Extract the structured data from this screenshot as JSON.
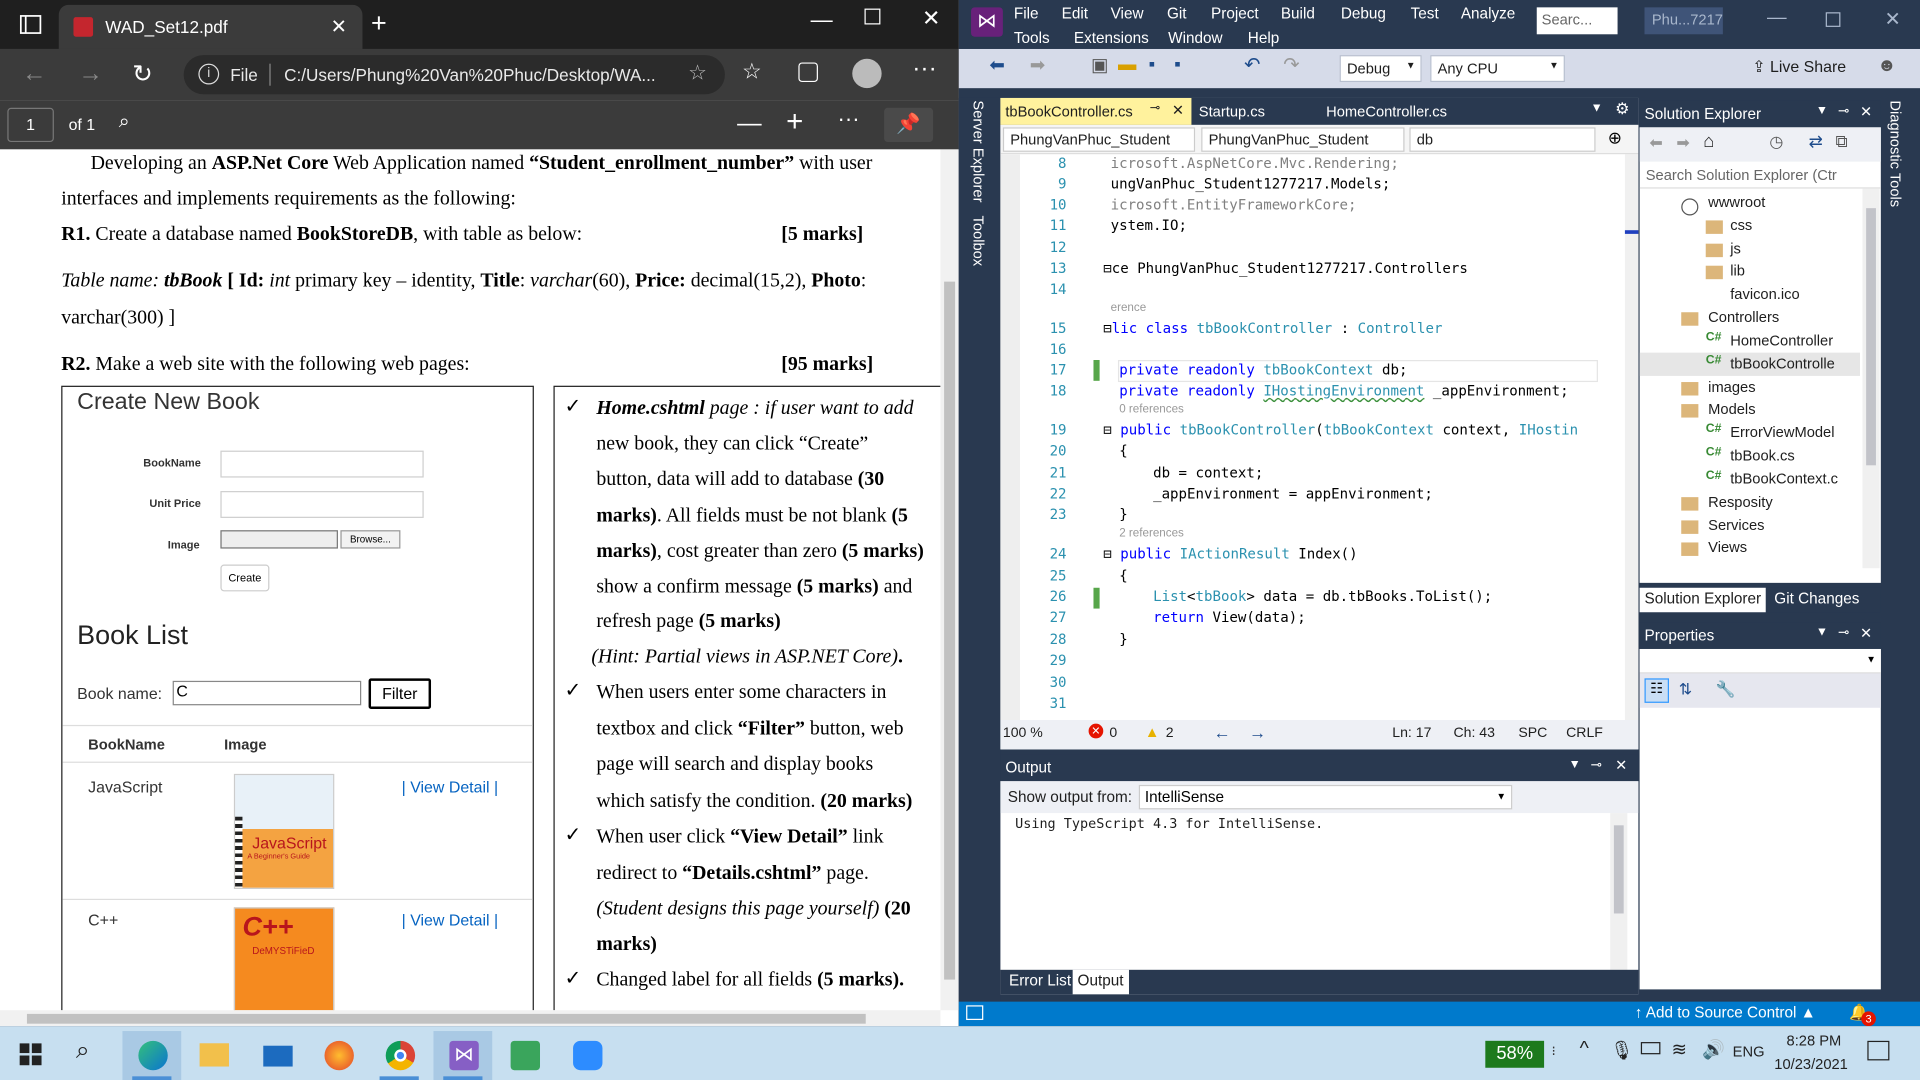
{
  "colors": {
    "edge_dark": "#1f1f1f",
    "edge_mid": "#3b3b3b",
    "vs_dark": "#293950",
    "vs_blue": "#007acc",
    "vs_active_tab": "#fff29d",
    "link_blue": "#0563c1"
  },
  "edge": {
    "tab_title": "WAD_Set12.pdf",
    "url_scheme": "File",
    "url": "C:/Users/Phung%20Van%20Phuc/Desktop/WA...",
    "page_number": "1",
    "page_total": "of 1"
  },
  "pdf": {
    "lines": [
      {
        "a": "Developing an ",
        "b": "ASP.Net Core",
        " c": "",
        "c": " Web Application named ",
        "d": "“Student_enrollment_number”",
        "e": " with user"
      },
      {
        "text": "interfaces and implements requirements as the following:"
      }
    ],
    "intro_1a": "Developing an ",
    "intro_1b": "ASP.Net Core",
    "intro_1c": " Web Application named ",
    "intro_1d": "“Student_enrollment_number”",
    "intro_1e": " with user",
    "intro_2": "interfaces and implements requirements as the following:",
    "r1_label": "R1.",
    "r1_text": " Create a database named ",
    "r1_db": "BookStoreDB",
    "r1_tail": ", with table as below:",
    "r1_marks": "[5 marks]",
    "tn_label": "Table name: ",
    "tn_name": "tbBook",
    "tn_bracket": " [ ",
    "tn_id": "Id:",
    "tn_int": " int",
    "tn_pk": " primary key – identity, ",
    "tn_title": "Title",
    "tn_colon": ": ",
    "tn_varchar": "varchar",
    "tn_60": "(60), ",
    "tn_price": "Price:",
    "tn_dec": " decimal(15,2), ",
    "tn_photo": "Photo",
    "tn_colon2": ":",
    "tn_line2": "varchar(300) ]",
    "r2_label": "R2.",
    "r2_text": " Make a web site with the following web pages:",
    "r2_marks": "[95 marks]",
    "fig": {
      "create_title": "Create New Book",
      "field_bookname": "BookName",
      "field_price": "Unit Price",
      "field_image": "Image",
      "browse": "Browse...",
      "create_btn": "Create",
      "list_title": "Book List",
      "filter_label": "Book name:",
      "filter_value": "C",
      "filter_btn": "Filter",
      "col_name": "BookName",
      "col_image": "Image",
      "rows": [
        {
          "name": "JavaScript",
          "link": "| View Detail |",
          "cover_title": "JavaScript",
          "cover_sub": "A Beginner's Guide"
        },
        {
          "name": "C++",
          "link": "| View Detail |",
          "cover_title": "C++",
          "cover_sub": "DeMYSTiFieD"
        }
      ]
    },
    "req": {
      "b1_1a": "Home.cshtml",
      "b1_1b": " page : if user want to add",
      "b1_2": "new book, they can click  “Create”",
      "b1_3a": "button, data will add to database ",
      "b1_3b": "(30",
      "b1_4a": "marks)",
      "b1_4b": ". All fields must be not blank ",
      "b1_4c": "(5",
      "b1_5a": "marks)",
      "b1_5b": ", cost greater than zero ",
      "b1_5c": "(5 marks)",
      "b1_6a": "show a confirm message ",
      "b1_6b": "(5 marks)",
      "b1_6c": " and",
      "b1_7a": "refresh page ",
      "b1_7b": "(5 marks)",
      "b1_8": "(Hint: Partial views in ASP.NET Core)",
      "b2_1": "When users enter some characters in",
      "b2_2a": "textbox and click ",
      "b2_2b": "“Filter”",
      "b2_2c": " button, web",
      "b2_3": "page will search and display books",
      "b2_4a": "which satisfy the condition. ",
      "b2_4b": "(20 marks)",
      "b3_1a": "When user click ",
      "b3_1b": "“View Detail”",
      "b3_1c": " link",
      "b3_2a": "redirect to ",
      "b3_2b": "“Details.cshtml”",
      "b3_2c": " page.",
      "b3_3a": "(Student designs this page yourself)",
      "b3_3b": " (20",
      "b3_4": "marks)",
      "b4_1a": "Changed label for all fields ",
      "b4_1b": "(5 marks)."
    }
  },
  "vs": {
    "menu": [
      "File",
      "Edit",
      "View",
      "Git",
      "Project",
      "Build",
      "Debug",
      "Test",
      "Analyze",
      "Tools",
      "Extensions",
      "Window",
      "Help"
    ],
    "search": "Searc...",
    "solution": "Phu...7217",
    "config": "Debug",
    "platform": "Any CPU",
    "live_share": "Live Share",
    "tabs": [
      "tbBookController.cs",
      "Startup.cs",
      "HomeController.cs"
    ],
    "nav": [
      "PhungVanPhuc_Student",
      "PhungVanPhuc_Student",
      "db"
    ],
    "code": [
      {
        "n": "8",
        "t": "icrosoft.AspNetCore.Mvc.Rendering;",
        "c": "gr"
      },
      {
        "n": "9",
        "t": "ungVanPhuc_Student1277217.Models;"
      },
      {
        "n": "10",
        "t": "icrosoft.EntityFrameworkCore;",
        "c": "gr"
      },
      {
        "n": "11",
        "t": "ystem.IO;"
      },
      {
        "n": "12",
        "t": ""
      },
      {
        "n": "13",
        "t": "ce PhungVanPhuc_Student1277217.Controllers"
      },
      {
        "n": "14",
        "t": ""
      },
      {
        "n": "15",
        "t": "lic class tbBookController : Controller"
      },
      {
        "n": "16",
        "t": ""
      },
      {
        "n": "17",
        "t": "private readonly tbBookContext db;"
      },
      {
        "n": "18",
        "t": "private readonly IHostingEnvironment _appEnvironment;"
      },
      {
        "n": "19",
        "t": "public tbBookController(tbBookContext context, IHostin"
      },
      {
        "n": "20",
        "t": "{"
      },
      {
        "n": "21",
        "t": "    db = context;"
      },
      {
        "n": "22",
        "t": "    _appEnvironment = appEnvironment;"
      },
      {
        "n": "23",
        "t": "}"
      },
      {
        "n": "24",
        "t": "public IActionResult Index()"
      },
      {
        "n": "25",
        "t": "{"
      },
      {
        "n": "26",
        "t": "    List<tbBook> data = db.tbBooks.ToList();"
      },
      {
        "n": "27",
        "t": "    return View(data);"
      },
      {
        "n": "28",
        "t": "}"
      },
      {
        "n": "29",
        "t": ""
      },
      {
        "n": "30",
        "t": ""
      },
      {
        "n": "31",
        "t": ""
      }
    ],
    "refs": {
      "r1": "erence",
      "r2": "0 references",
      "r3": "2 references"
    },
    "status_ed": {
      "zoom": "100 %",
      "errors": "0",
      "warnings": "2",
      "line": "Ln: 17",
      "ch": "Ch: 43",
      "spc": "SPC",
      "crlf": "CRLF"
    },
    "output": {
      "title": "Output",
      "show_from_label": "Show output from:",
      "source": "IntelliSense",
      "text": "Using TypeScript 4.3 for IntelliSense."
    },
    "bottom_tabs": [
      "Error List",
      "Output"
    ],
    "se": {
      "title": "Solution Explorer",
      "search": "Search Solution Explorer (Ctr",
      "items": [
        {
          "t": "wwwroot",
          "lvl": 0
        },
        {
          "t": "css",
          "lvl": 1
        },
        {
          "t": "js",
          "lvl": 1
        },
        {
          "t": "lib",
          "lvl": 1
        },
        {
          "t": "favicon.ico",
          "lvl": 1
        },
        {
          "t": "Controllers",
          "lvl": 0
        },
        {
          "t": "HomeController",
          "lvl": 1
        },
        {
          "t": "tbBookControlle",
          "lvl": 1
        },
        {
          "t": "images",
          "lvl": 0
        },
        {
          "t": "Models",
          "lvl": 0
        },
        {
          "t": "ErrorViewModel",
          "lvl": 1
        },
        {
          "t": "tbBook.cs",
          "lvl": 1
        },
        {
          "t": "tbBookContext.c",
          "lvl": 1
        },
        {
          "t": "Resposity",
          "lvl": 0
        },
        {
          "t": "Services",
          "lvl": 0
        },
        {
          "t": "Views",
          "lvl": 0
        }
      ],
      "tabs": [
        "Solution Explorer",
        "Git Changes"
      ]
    },
    "props_title": "Properties",
    "side_left": [
      "Server Explorer",
      "Toolbox"
    ],
    "side_right": "Diagnostic Tools",
    "status": "Add to Source Control",
    "notif": "3"
  },
  "taskbar": {
    "battery": "58%",
    "lang": "ENG",
    "time": "8:28 PM",
    "date": "10/23/2021"
  }
}
